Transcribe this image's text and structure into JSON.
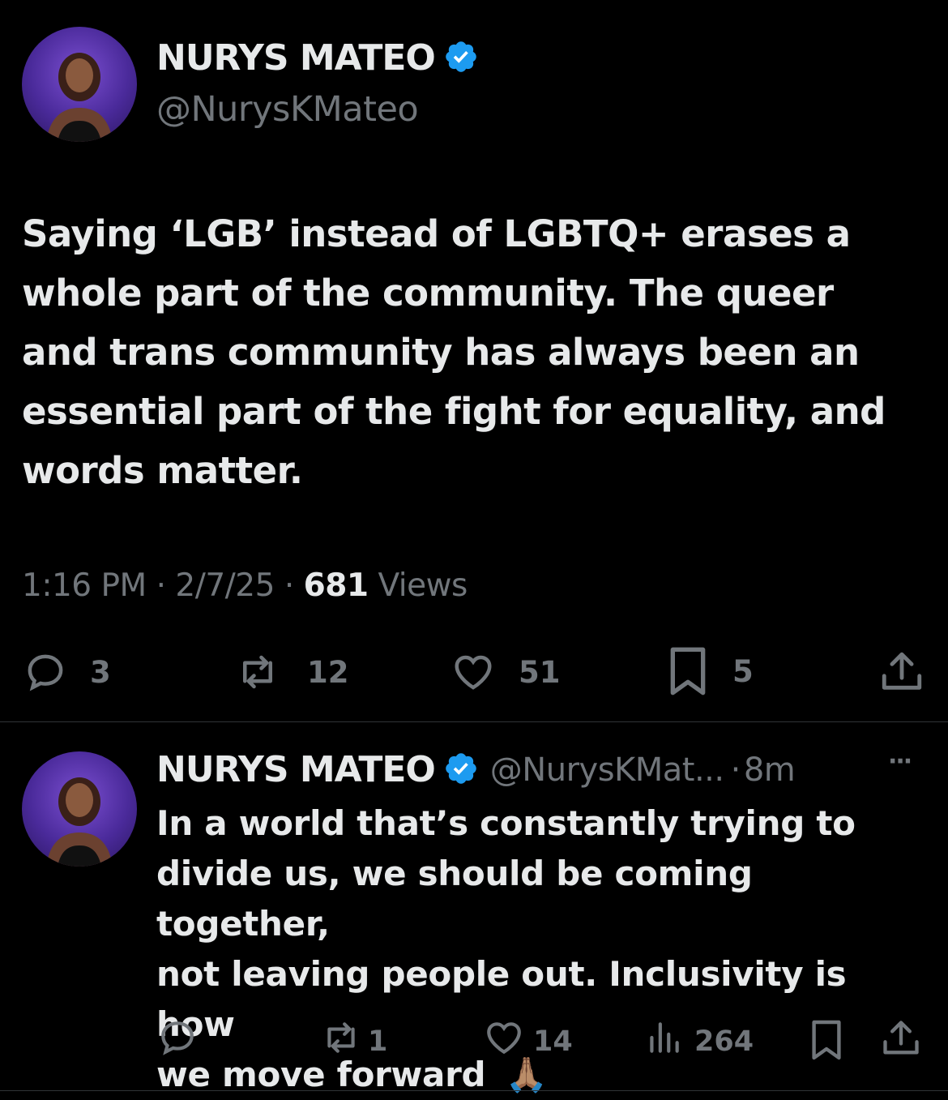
{
  "tweet": {
    "author_name": "NURYS MATEO",
    "author_handle": "@NurysKMateo",
    "text": "Saying ‘LGB’ instead of LGBTQ+ erases a whole part of the community. The queer and trans community has always been an essential part of the fight for equality, and words matter.",
    "lines": [
      "Saying ‘LGB’ instead of LGBTQ+ erases a",
      "whole part of the community. The queer",
      "and trans community has always been an",
      "essential part of the fight for equality, and",
      "words matter."
    ],
    "time": "1:16 PM",
    "date": "2/7/25",
    "separator": "·",
    "views_count": "681",
    "views_label": "Views",
    "replies": "3",
    "reposts": "12",
    "likes": "51",
    "bookmarks": "5"
  },
  "reply": {
    "author_name": "NURYS MATEO",
    "author_handle": "@NurysKMat...",
    "separator": "·",
    "age": "8m",
    "more": "···",
    "lines": [
      "In a world that’s constantly trying to",
      "divide us, we should be coming together,",
      "not leaving people out. Inclusivity is how",
      "we move forward"
    ],
    "emoji": "🙏🏽",
    "replies": "",
    "reposts": "1",
    "likes": "14",
    "views": "264"
  },
  "colors": {
    "background": "#000000",
    "text": "#e7e9ea",
    "muted": "#71767b",
    "verified": "#1d9bf0",
    "divider": "#2f3336"
  }
}
